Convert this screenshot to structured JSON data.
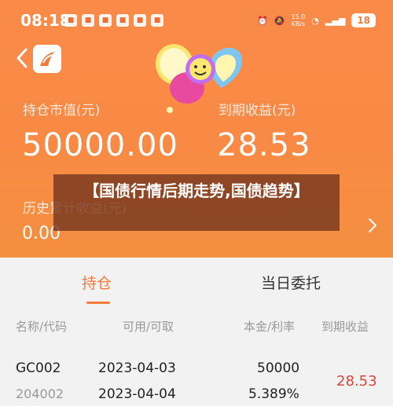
{
  "status_bar": {
    "time": "08:18",
    "notif_icons": [
      "app-icon-1",
      "app-icon-2",
      "app-icon-3",
      "app-icon-4",
      "app-icon-5",
      "app-icon-6"
    ],
    "net_speed_value": "15.0",
    "net_speed_unit": "KB/s",
    "battery": "18"
  },
  "header": {
    "holding_value_label": "持仓市值(元)",
    "holding_value": "50000.00",
    "maturity_income_label": "到期收益(元)",
    "maturity_income": "28.53",
    "history_income_label": "历史累计收益(元)",
    "history_income": "0.00"
  },
  "banner": {
    "text": "【国债行情后期走势,国债趋势】"
  },
  "tabs": [
    {
      "label": "持仓",
      "active": true
    },
    {
      "label": "当日委托",
      "active": false
    }
  ],
  "table": {
    "columns": [
      "名称/代码",
      "可用/可取",
      "本金/利率",
      "到期收益"
    ],
    "rows": [
      {
        "name": "GC002",
        "code": "204002",
        "available_date": "2023-04-03",
        "withdrawable_date": "2023-04-04",
        "principal": "50000",
        "rate": "5.389%",
        "maturity_income": "28.53"
      }
    ]
  },
  "colors": {
    "header_orange": "#fa8a48",
    "accent": "#f47a3c",
    "income_red": "#d9473b"
  }
}
